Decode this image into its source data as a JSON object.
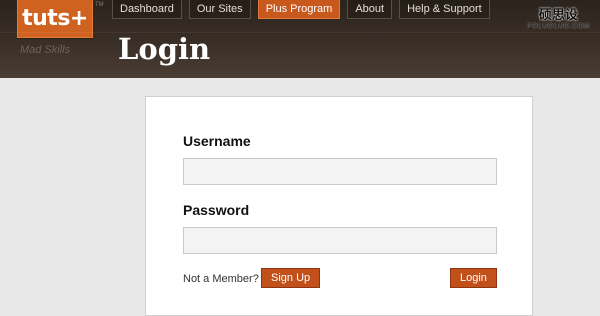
{
  "header": {
    "logo_text": "tuts+",
    "trademark": "TM",
    "tagline": "Mad Skills",
    "nav": [
      {
        "label": "Dashboard",
        "active": false
      },
      {
        "label": "Our Sites",
        "active": false
      },
      {
        "label": "Plus Program",
        "active": true
      },
      {
        "label": "About",
        "active": false
      },
      {
        "label": "Help & Support",
        "active": false
      }
    ],
    "page_title": "Login"
  },
  "watermark": {
    "line1": "硕思设",
    "line2": "POLUOLUO.COM"
  },
  "form": {
    "username_label": "Username",
    "username_value": "",
    "password_label": "Password",
    "password_value": "",
    "member_text": "Not a Member?",
    "signup_label": "Sign Up",
    "login_label": "Login"
  },
  "colors": {
    "accent": "#c9581d",
    "header_bg": "#3a2f27",
    "page_bg": "#e8e8e8"
  }
}
